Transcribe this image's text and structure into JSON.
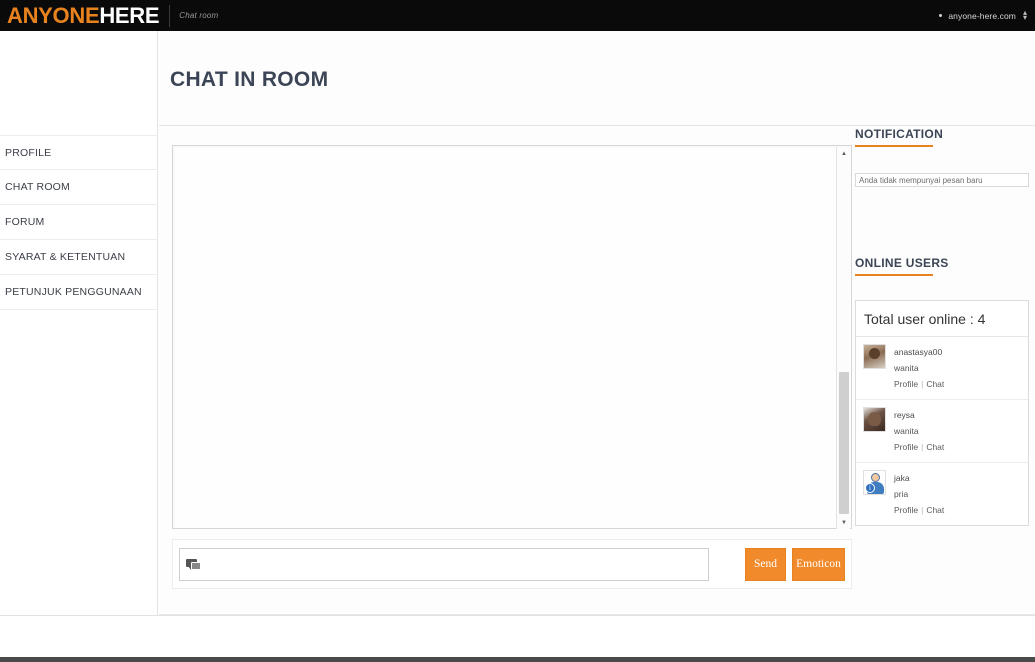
{
  "topbar": {
    "logo_orange": "ANYONE",
    "logo_white": "HERE",
    "tagline": "Chat room",
    "site_name": "anyone-here.com",
    "bullet_icon": "bullet-dot-icon",
    "caret_icon": "sort-caret-icon"
  },
  "sidebar": {
    "items": [
      {
        "label": "PROFILE",
        "name": "profile"
      },
      {
        "label": "CHAT ROOM",
        "name": "chat-room"
      },
      {
        "label": "FORUM",
        "name": "forum"
      },
      {
        "label": "SYARAT & KETENTUAN",
        "name": "syarat-ketentuan"
      },
      {
        "label": "PETUNJUK PENGGUNAAN",
        "name": "petunjuk-penggunaan"
      }
    ]
  },
  "main": {
    "page_title": "CHAT IN ROOM",
    "chat_log": "",
    "scrollbar": {
      "up_arrow": "▲",
      "down_arrow": "▼"
    },
    "composer": {
      "input_value": "",
      "input_placeholder": "",
      "bubble_icon": "chat-bubble-icon",
      "send_label": "Send",
      "emoticon_label": "Emoticon"
    }
  },
  "right": {
    "notification": {
      "heading": "NOTIFICATION",
      "message": "Anda tidak mempunyai pesan baru"
    },
    "online_users": {
      "heading": "ONLINE USERS",
      "total_label": "Total user online : 4",
      "profile_link": "Profile",
      "chat_link": "Chat",
      "separator": "|",
      "users": [
        {
          "name": "anastasya00",
          "gender": "wanita",
          "avatar": "avatar-photo-anastasya00"
        },
        {
          "name": "reysa",
          "gender": "wanita",
          "avatar": "avatar-photo-reysa"
        },
        {
          "name": "jaka",
          "gender": "pria",
          "avatar": "avatar-person-jaka",
          "badge": "i"
        }
      ]
    }
  },
  "colors": {
    "accent": "#e8821e",
    "button": "#f08a2a",
    "topbar_bg": "#0a0a0a",
    "title_text": "#3c4556"
  }
}
